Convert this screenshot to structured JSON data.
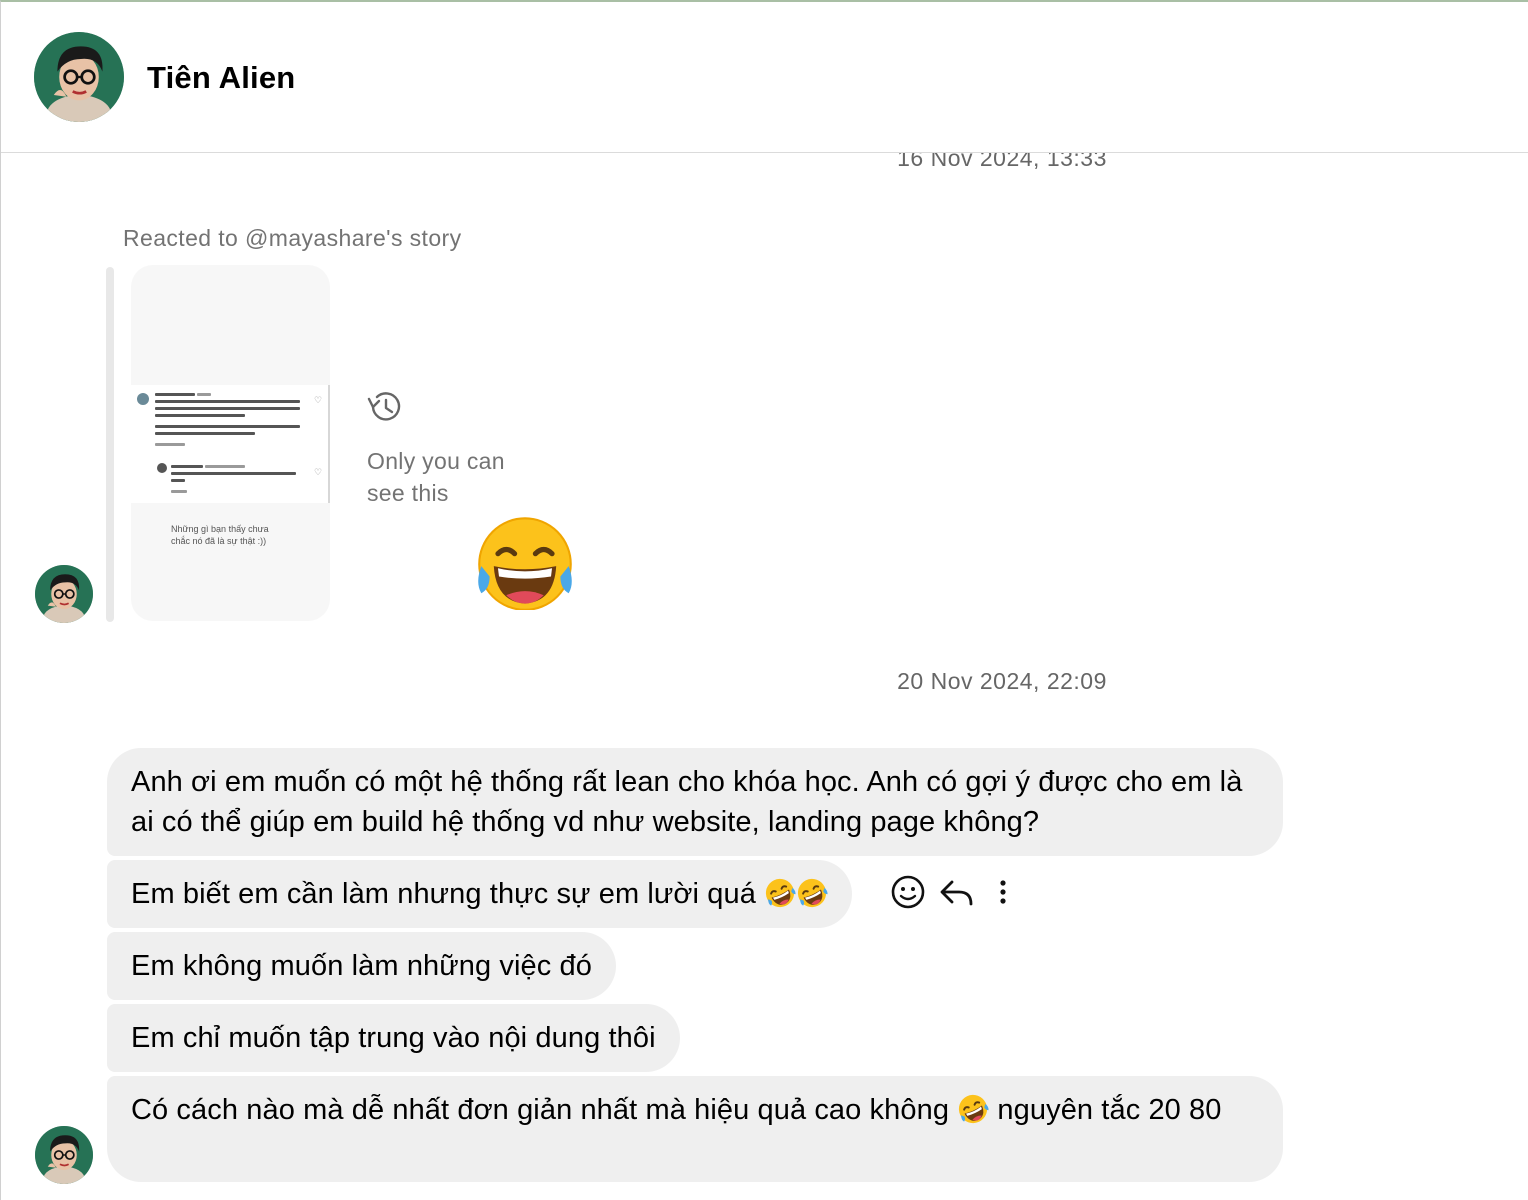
{
  "header": {
    "contact_name": "Tiên Alien",
    "avatar_icon": "profile-photo"
  },
  "thread": {
    "timestamp_top": "16 Nov 2024, 13:33",
    "reacted_label": "Reacted to @mayashare's story",
    "story": {
      "caption_line1": "Những gì bạn thấy chưa",
      "caption_line2": "chắc nó đã là sự thật :))"
    },
    "only_you_label": "Only you can see this",
    "reaction_icon": "face-with-tears-of-joy-icon",
    "timestamp_mid": "20 Nov 2024, 22:09",
    "messages": [
      {
        "text": "Anh ơi em muốn có một hệ thống rất lean cho khóa học. Anh có gợi ý được cho em là ai có thể giúp em build hệ thống vd như website, landing page không?"
      },
      {
        "text": "Em biết em cần làm nhưng thực sự em lười quá",
        "emoji_suffix": "rolling-on-floor-laughing x2"
      },
      {
        "text": "Em không muốn làm những việc đó"
      },
      {
        "text": "Em chỉ muốn tập trung vào nội dung thôi"
      },
      {
        "text_before": "Có cách nào mà dễ nhất đơn giản nhất mà hiệu quả cao không",
        "emoji": "rolling-on-floor-laughing",
        "text_after": "nguyên tắc 20 80"
      }
    ],
    "hover_actions": [
      "react-icon",
      "reply-icon",
      "more-options-icon"
    ]
  },
  "colors": {
    "bubble_bg": "#efefef",
    "muted_text": "#737373",
    "divider": "#dbdbdb",
    "top_accent": "#a9bfa5"
  }
}
